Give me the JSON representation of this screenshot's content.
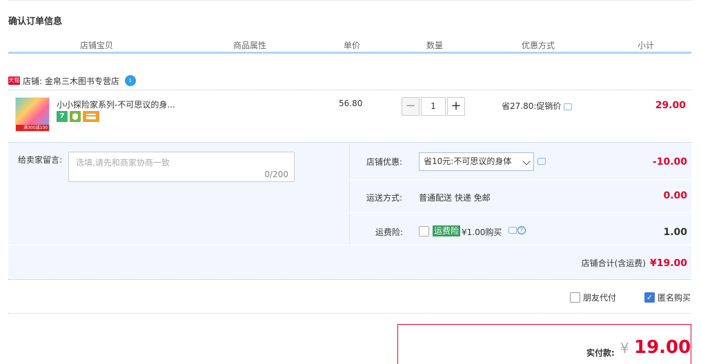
{
  "page": {
    "title": "确认订单信息"
  },
  "columns": [
    "店铺宝贝",
    "商品属性",
    "单价",
    "数量",
    "优惠方式",
    "小计"
  ],
  "shop": {
    "tmall_badge": "天猫",
    "label": "店铺: 金帛三木图书专营店",
    "ww_badge": "1"
  },
  "item": {
    "title": "小小探险家系列-不可思议的身...",
    "thumb_badge": "满300减100",
    "badge_seven": "7",
    "unit_price": "56.80",
    "quantity": "1",
    "minus_label": "−",
    "plus_label": "+",
    "discount": "省27.80:促销价",
    "subtotal": "29.00"
  },
  "memo": {
    "label": "给卖家留言:",
    "placeholder": "选填,请先和商家协商一致",
    "count": "0/200"
  },
  "shop_discount": {
    "label": "店铺优惠:",
    "selected": "省10元:不可思议的身体",
    "amount": "-10.00"
  },
  "shipping": {
    "label": "运送方式:",
    "value": "普通配送 快递 免邮",
    "amount": "0.00"
  },
  "insurance": {
    "label": "运费险:",
    "tag": "运费险",
    "price": "¥1.00购买",
    "help": "?",
    "amount": "1.00"
  },
  "shop_total": {
    "label": "店铺合计(含运费)",
    "amount": "¥19.00"
  },
  "options": {
    "friend_pay": "朋友代付",
    "anonymous": "匿名购买",
    "anonymous_checked": true,
    "check_mark": "✓"
  },
  "payment": {
    "label": "实付款:",
    "currency": "¥",
    "amount": "19.00"
  }
}
